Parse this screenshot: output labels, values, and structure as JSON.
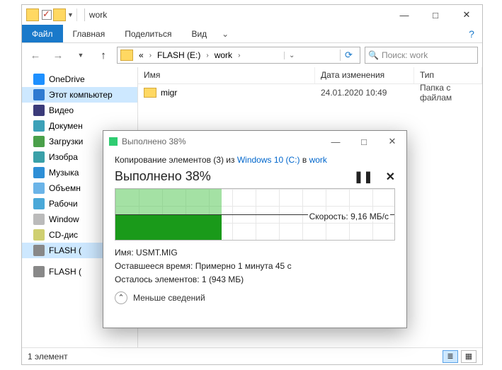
{
  "window": {
    "title": "work",
    "controls": {
      "min": "—",
      "max": "□",
      "close": "✕"
    }
  },
  "ribbon": {
    "file": "Файл",
    "home": "Главная",
    "share": "Поделиться",
    "view": "Вид"
  },
  "address": {
    "breadcrumb": [
      "«",
      "FLASH (E:)",
      "work"
    ],
    "refresh": "⟳"
  },
  "search": {
    "placeholder": "Поиск: work"
  },
  "nav": {
    "items": [
      {
        "label": "OneDrive",
        "icon": "ic-cloud"
      },
      {
        "label": "Этот компьютер",
        "icon": "ic-pc",
        "sel": true
      },
      {
        "label": "Видео",
        "icon": "ic-vid"
      },
      {
        "label": "Докумен",
        "icon": "ic-doc"
      },
      {
        "label": "Загрузки",
        "icon": "ic-dl"
      },
      {
        "label": "Изобра",
        "icon": "ic-img"
      },
      {
        "label": "Музыка",
        "icon": "ic-mus"
      },
      {
        "label": "Объемн",
        "icon": "ic-vol"
      },
      {
        "label": "Рабочи",
        "icon": "ic-desk"
      },
      {
        "label": "Window",
        "icon": "ic-win"
      },
      {
        "label": "CD-дис",
        "icon": "ic-cd"
      },
      {
        "label": "FLASH (",
        "icon": "ic-usb",
        "sel": true
      },
      {
        "label": "",
        "icon": ""
      },
      {
        "label": "FLASH (",
        "icon": "ic-usb"
      }
    ]
  },
  "columns": {
    "name": "Имя",
    "date": "Дата изменения",
    "type": "Тип"
  },
  "rows": [
    {
      "name": "migr",
      "date": "24.01.2020 10:49",
      "type": "Папка с файлам"
    }
  ],
  "status": {
    "count": "1 элемент"
  },
  "dialog": {
    "title": "Выполнено 38%",
    "line1_pre": "Копирование элементов (3) из ",
    "line1_src": "Windows 10 (C:)",
    "line1_mid": " в ",
    "line1_dst": "work",
    "headline": "Выполнено 38%",
    "speed_label": "Скорость: 9,16 МБ/с",
    "name_line": "Имя: USMT.MIG",
    "time_line": "Оставшееся время: Примерно 1 минута 45 с",
    "remain_line": "Осталось элементов: 1 (943 МБ)",
    "toggle": "Меньше сведений",
    "pause": "❚❚",
    "cancel": "✕",
    "controls": {
      "min": "—",
      "max": "□",
      "close": "✕"
    }
  }
}
